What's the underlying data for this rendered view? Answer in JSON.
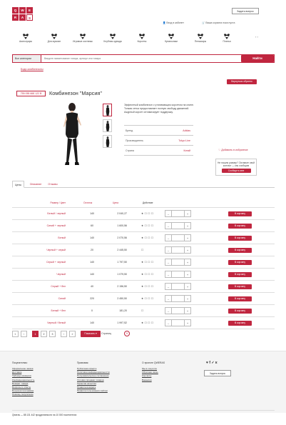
{
  "header": {
    "logo_letters": [
      "Q",
      "W",
      "E",
      "R",
      "A",
      "S"
    ],
    "login_link": "Вход в кабинет",
    "cart_link": "Ваша корзина пока пуста",
    "callback_button": "Задать вопрос"
  },
  "nav": {
    "items": [
      {
        "label": "Аксессуары",
        "icon": "lingerie-icon"
      },
      {
        "label": "Для мужчин",
        "icon": "lingerie-icon"
      },
      {
        "label": "Игровые костюмы",
        "icon": "lingerie-icon"
      },
      {
        "label": "Клубная одежда",
        "icon": "lingerie-icon"
      },
      {
        "label": "Корсеты",
        "icon": "lingerie-icon"
      },
      {
        "label": "Купальники",
        "icon": "lingerie-icon"
      },
      {
        "label": "Пеньюары",
        "icon": "lingerie-icon"
      },
      {
        "label": "Платья",
        "icon": "lingerie-icon"
      }
    ],
    "arrows": "‹ ›"
  },
  "search": {
    "category_label": "Все категории",
    "placeholder": "Введите наименование товара, артикул или товара",
    "button": "Найти"
  },
  "breadcrumb": "Боди-комбинезоны",
  "back_button": "Вернуться обратно",
  "product": {
    "sku": "755 055 668 122 В",
    "title": "Комбинезон \"Марсия\"",
    "description": "Эффектный комбинезон с утягивающим корсетом на спине. Тонкая сетка предоставляет полную свободу движений. Ажурный корсет оптимизирует поддержку.",
    "specs": [
      {
        "key": "Бренд",
        "value": "Adidas"
      },
      {
        "key": "Производитель",
        "value": "Tokyo Line"
      },
      {
        "key": "Страна",
        "value": "Китай"
      }
    ],
    "favorite": "Добавить в избранное",
    "notify_text": "Не нашли размер? Оставьте свой контакт — мы сообщим",
    "notify_button": "Сообщить мне"
  },
  "tabs": [
    {
      "label": "Цены",
      "active": true
    },
    {
      "label": "Описание",
      "active": false
    },
    {
      "label": "Отзывы",
      "active": false
    }
  ],
  "price_table": {
    "headers": [
      "Размер / Цвет",
      "Остаток",
      "Цена",
      "Действие"
    ],
    "rows": [
      {
        "name": "Белый / черный",
        "qty": "140",
        "price": "2 040,27",
        "icons": "★ ☐ ☐ ☐"
      },
      {
        "name": "Синий + черный",
        "qty": "60",
        "price": "1 600,56",
        "icons": "★ ☐ ☐ ☐"
      },
      {
        "name": "Белый",
        "qty": "140",
        "price": "2 070,56",
        "icons": "★ ☐ ☐ ☐"
      },
      {
        "name": "Черный + серый",
        "qty": "20",
        "price": "2 445,50",
        "icons": "☐"
      },
      {
        "name": "Серый + черный",
        "qty": "140",
        "price": "1 797,50",
        "icons": "★ ☐ ☐ ☐"
      },
      {
        "name": "Черный",
        "qty": "140",
        "price": "1 079,50",
        "icons": "★ ☐ ☐ ☐"
      },
      {
        "name": "Серый + бел",
        "qty": "40",
        "price": "2 156,50",
        "icons": "★ ☐ ☐ ☐"
      },
      {
        "name": "Синий",
        "qty": "220",
        "price": "2 450,50",
        "icons": "★ ☐ ☐ ☐"
      },
      {
        "name": "Белый + бел",
        "qty": "0",
        "price": "181,20",
        "icons": "☐"
      },
      {
        "name": "Черный / белый",
        "qty": "140",
        "price": "1 997,52",
        "icons": "★ ☐ ☐ ☐"
      }
    ],
    "minus": "–",
    "plus": "+",
    "cart_button": "В корзину"
  },
  "pager": {
    "items": [
      {
        "label": "«",
        "active": false
      },
      {
        "label": "‹",
        "active": false
      },
      {
        "label": "1",
        "active": true
      },
      {
        "label": "2",
        "active": false
      },
      {
        "label": "3",
        "active": false
      },
      {
        "label": "›",
        "active": false
      },
      {
        "label": "»",
        "active": false
      }
    ],
    "show_label": "Показать ▾",
    "show_count": "Страниц",
    "show_badge": "5"
  },
  "footer": {
    "columns": [
      {
        "heading": "Покупателям:",
        "links": [
          "Оформление заказа",
          "Доставка",
          "Таблица размеров",
          "Конфиденциальность",
          "Возврат товара",
          "Вопросы и ответы",
          "Бонусная программа",
          "Помощь покупателю"
        ]
      },
      {
        "heading": "Правовая:",
        "links": [
          "Публичная оферта",
          "Политика конфиденциальности",
          "Пользовательское соглашение",
          "Условия продажи товаров",
          "Гарантии качества",
          "Правила возврата",
          "Правила пользования сайтом"
        ]
      },
      {
        "heading": "О проекте QWERAS",
        "links": [
          "Мы в соцсетях",
          "Обратная связь",
          "Контакты",
          "Вакансии"
        ]
      }
    ],
    "social": "♥ f ✓ к",
    "callback_button": "Задать вопрос",
    "copyright": "Qweras — 88 131 442 продуктивности на 10 000 посетителях"
  }
}
